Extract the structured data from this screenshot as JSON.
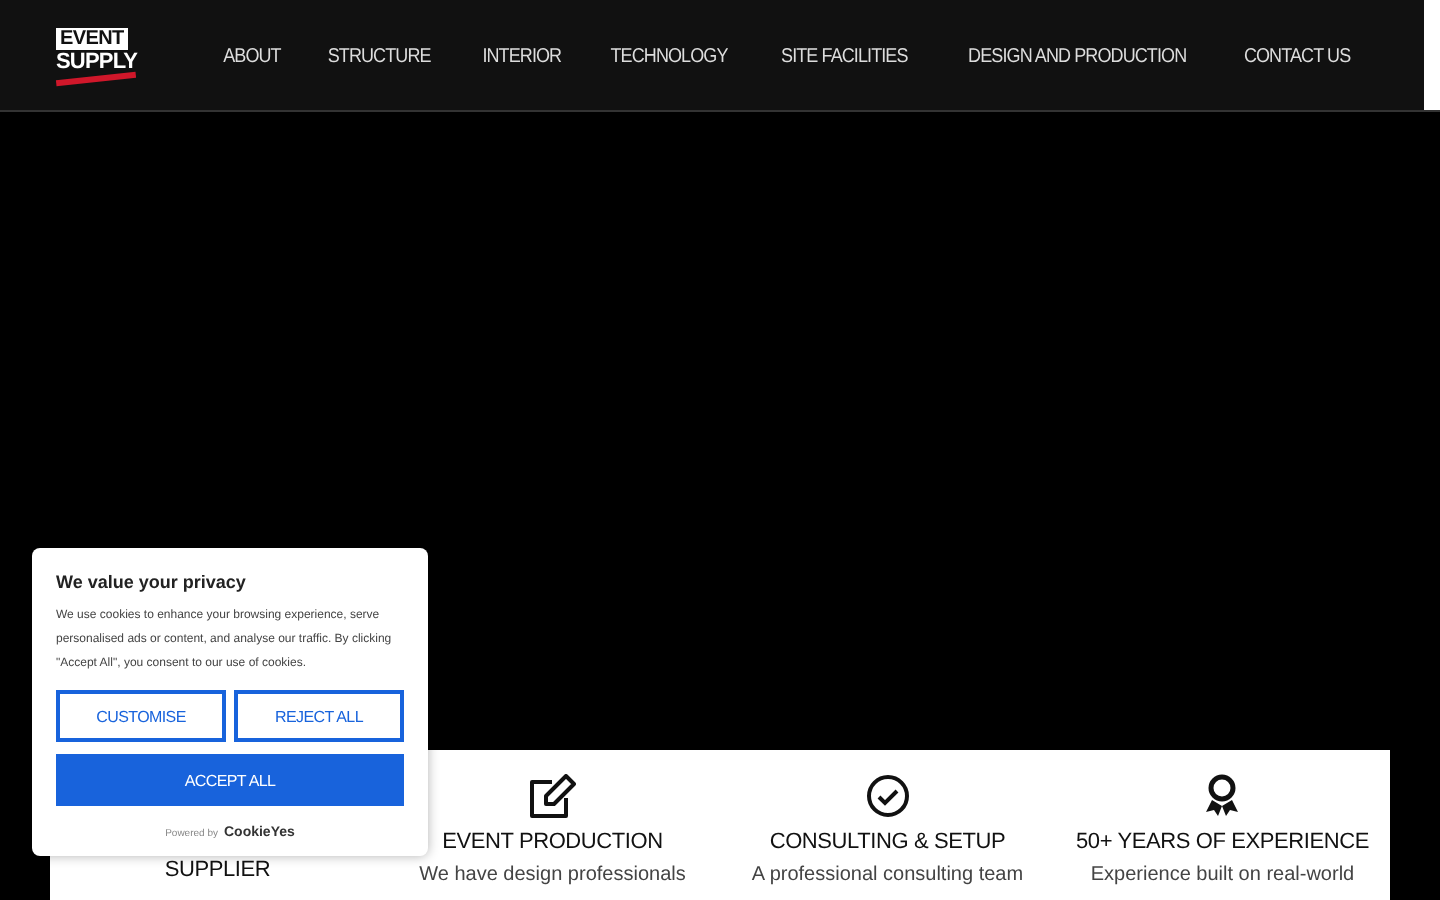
{
  "header": {
    "logo": {
      "line_1": "EVENT",
      "line_2": "SUPPLY"
    },
    "nav": [
      {
        "label": "ABOUT"
      },
      {
        "label": "STRUCTURE"
      },
      {
        "label": "INTERIOR"
      },
      {
        "label": "TECHNOLOGY"
      },
      {
        "label": "SITE FACILITIES"
      },
      {
        "label": "DESIGN AND PRODUCTION"
      },
      {
        "label": "CONTACT US"
      }
    ]
  },
  "features": [
    {
      "kind": "hidden",
      "title": "SUPPLIER"
    },
    {
      "kind": "edit",
      "title": "EVENT PRODUCTION",
      "text": "We have design professionals"
    },
    {
      "kind": "check",
      "title": "CONSULTING & SETUP",
      "text": "A professional consulting team"
    },
    {
      "kind": "award",
      "title": "50+ YEARS OF EXPERIENCE",
      "text": "Experience built on real-world"
    }
  ],
  "cookie_banner": {
    "title": "We value your privacy",
    "text": "We use cookies to enhance your browsing experience, serve personalised ads or content, and analyse our traffic. By clicking \"Accept All\", you consent to our use of cookies.",
    "buttons": [
      {
        "kind": "outline",
        "label": "CUSTOMISE"
      },
      {
        "kind": "outline",
        "label": "REJECT ALL"
      },
      {
        "kind": "primary",
        "label": "ACCEPT ALL"
      }
    ],
    "powered_by": "Powered by",
    "brand": "CookieYes"
  }
}
